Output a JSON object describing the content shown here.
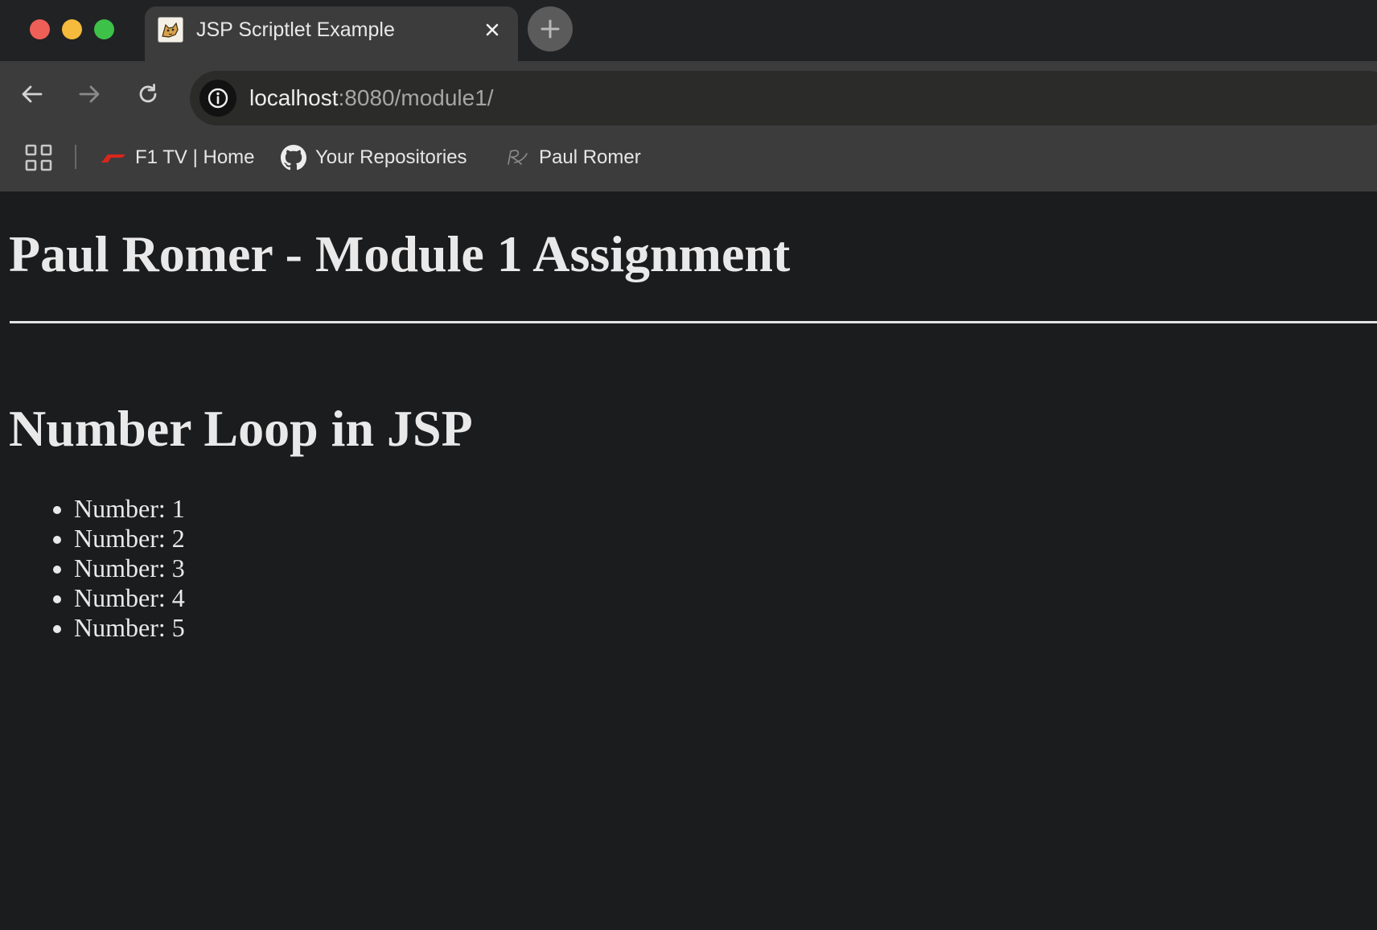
{
  "browser": {
    "tab": {
      "title": "JSP Scriptlet Example",
      "favicon": "tomcat-icon"
    },
    "address_bar": {
      "host": "localhost",
      "rest": ":8080/module1/"
    },
    "bookmarks": [
      {
        "label": "F1 TV | Home",
        "icon": "f1-icon",
        "accent": "#d9261c"
      },
      {
        "label": "Your Repositories",
        "icon": "github-icon"
      },
      {
        "label": "Paul Romer",
        "icon": "signature-icon"
      }
    ]
  },
  "page": {
    "heading": "Paul Romer - Module 1 Assignment",
    "subheading": "Number Loop in JSP",
    "items": [
      "Number: 1",
      "Number: 2",
      "Number: 3",
      "Number: 4",
      "Number: 5"
    ]
  },
  "colors": {
    "page_background": "#1b1c1e",
    "text": "#e9e9e9",
    "toolbar": "#3c3c3d",
    "tabstrip": "#212224",
    "traffic_close": "#ee5f58",
    "traffic_minimize": "#f6bb3c",
    "traffic_maximize": "#3dc149"
  }
}
